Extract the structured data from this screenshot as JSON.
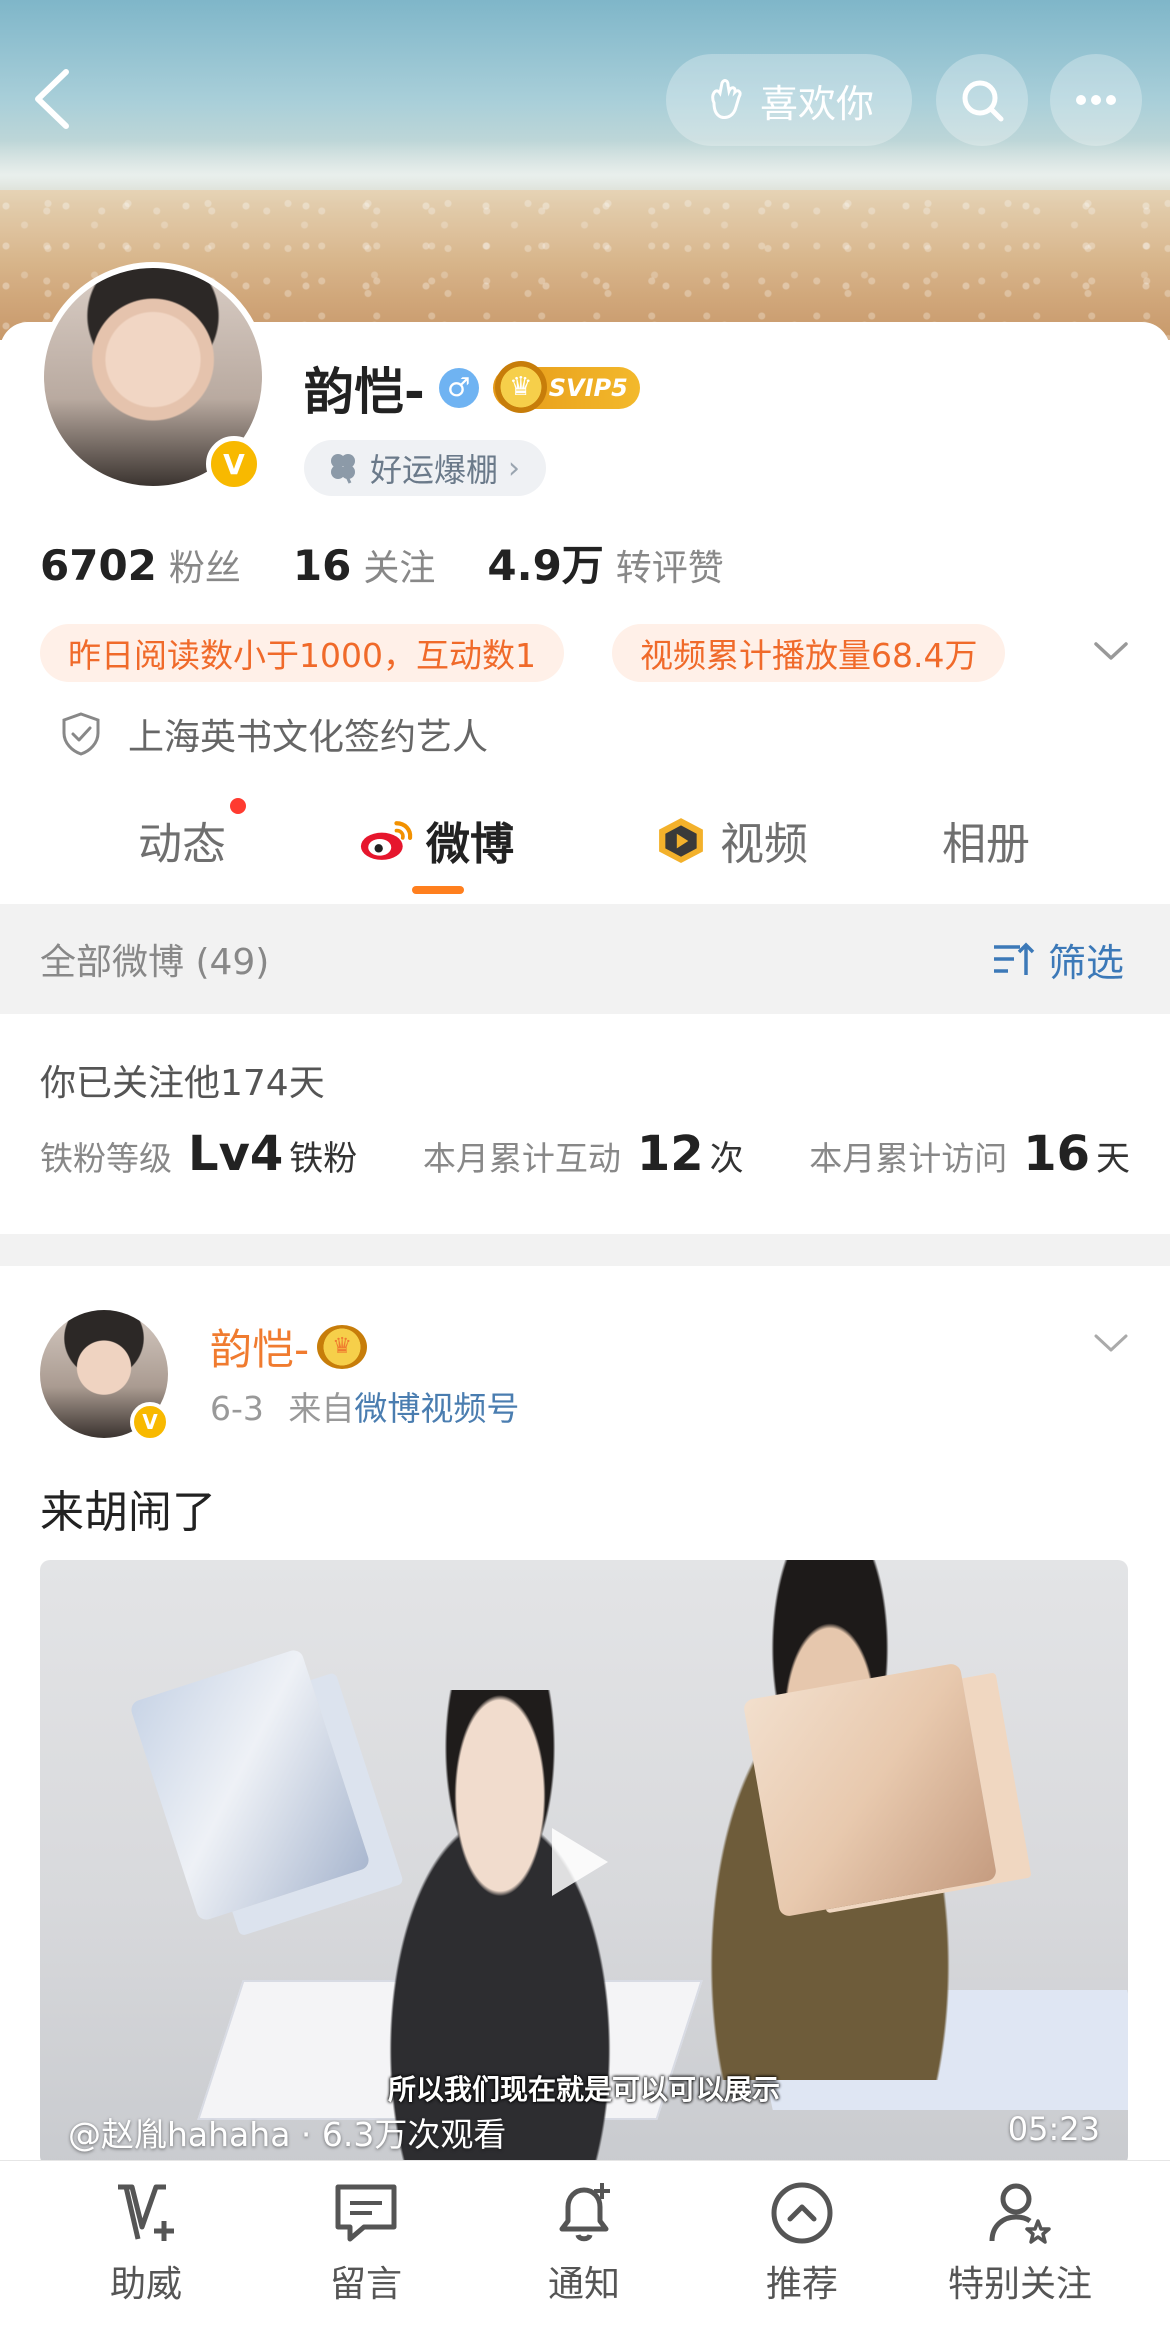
{
  "header": {
    "like_label": "喜欢你",
    "colors": {
      "accent": "#ff7f1e",
      "link": "#3c79b8"
    }
  },
  "profile": {
    "name": "韵恺-",
    "gender_icon": "♂",
    "vip_label": "SVIP5",
    "luck_tag": "好运爆棚",
    "stats": [
      {
        "value": "6702",
        "label": "粉丝"
      },
      {
        "value": "16",
        "label": "关注"
      },
      {
        "value": "4.9万",
        "label": "转评赞"
      }
    ],
    "pills": [
      "昨日阅读数小于1000，互动数1",
      "视频累计播放量68.4万"
    ],
    "certification": "上海英书文化签约艺人"
  },
  "tabs": [
    {
      "label": "动态",
      "has_dot": true
    },
    {
      "label": "微博",
      "active": true
    },
    {
      "label": "视频"
    },
    {
      "label": "相册"
    }
  ],
  "filter": {
    "label": "全部微博 (49)",
    "button": "筛选"
  },
  "fan": {
    "follow_days": "你已关注他174天",
    "level_label": "铁粉等级",
    "level_value": "Lv4",
    "level_suffix": "铁粉",
    "interact_label": "本月累计互动",
    "interact_value": "12",
    "interact_suffix": "次",
    "visit_label": "本月累计访问",
    "visit_value": "16",
    "visit_suffix": "天"
  },
  "post": {
    "author": "韵恺-",
    "date": "6-3",
    "from_prefix": "来自",
    "source": "微博视频号",
    "text": "来胡闹了",
    "video": {
      "subtitle": "所以我们现在就是可以可以展示",
      "info": "@赵胤hahaha · 6.3万次观看",
      "duration": "05:23"
    }
  },
  "bottom_bar": [
    {
      "label": "助威",
      "icon": "cheer-icon"
    },
    {
      "label": "留言",
      "icon": "message-icon"
    },
    {
      "label": "通知",
      "icon": "bell-add-icon"
    },
    {
      "label": "推荐",
      "icon": "recommend-icon"
    },
    {
      "label": "特别关注",
      "icon": "special-follow-icon"
    }
  ]
}
